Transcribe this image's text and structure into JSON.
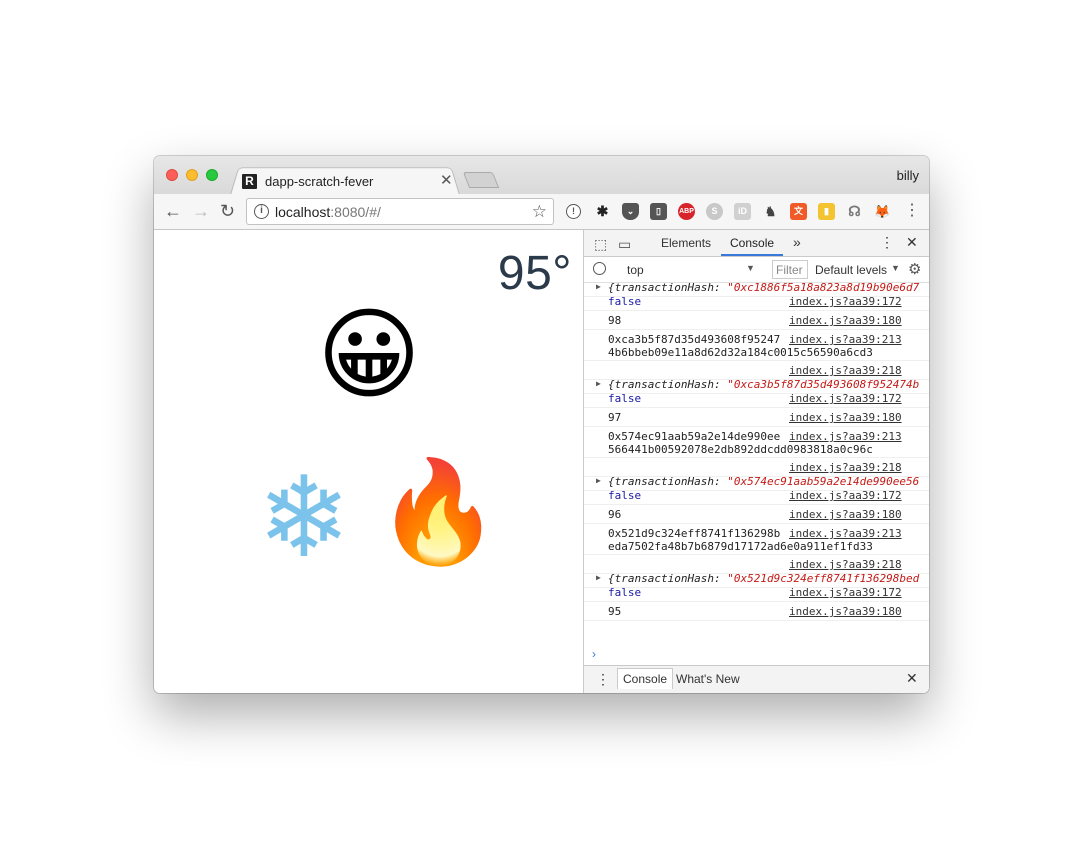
{
  "browser": {
    "tab_title": "dapp-scratch-fever",
    "favicon_letter": "R",
    "tab_close": "✕",
    "profile_name": "billy",
    "url_host": "localhost",
    "url_rest": ":8080/#/",
    "back": "←",
    "forward": "→",
    "reload": "↻",
    "star": "☆",
    "extensions": [
      "info-ext-icon",
      "password-ext-icon",
      "pocket-icon",
      "bitwarden-icon",
      "adblock-plus-icon",
      "skype-icon",
      "id-ext-icon",
      "evernote-icon",
      "translate-icon",
      "highlighter-icon",
      "ghostery-icon",
      "metamask-icon"
    ],
    "extension_labels": {
      "adblock": "ABP",
      "id": "iD"
    },
    "menu": "⋮"
  },
  "page": {
    "temperature": "95°",
    "face_emoji": "😀",
    "snow_emoji": "❄",
    "fire_emoji": "🔥"
  },
  "devtools": {
    "tabs": [
      "Elements",
      "Console"
    ],
    "more": "»",
    "context": "top",
    "filter_placeholder": "Filter",
    "levels": "Default levels",
    "drawer_tabs": [
      "Console",
      "What's New"
    ],
    "logs": [
      {
        "kind": "obj",
        "text": "{transactionHash: ",
        "str": "\"0xc1886f5a18a823a8d19b90e6d7"
      },
      {
        "kind": "bool",
        "text": "false",
        "src": "index.js?aa39:172"
      },
      {
        "kind": "plain",
        "text": "98",
        "src": "index.js?aa39:180"
      },
      {
        "kind": "hash",
        "text": "0xca3b5f87d35d493608f95247\n4b6bbeb09e11a8d62d32a184c0015c56590a6cd3",
        "src": "index.js?aa39:213"
      },
      {
        "kind": "srconly",
        "src": "index.js?aa39:218"
      },
      {
        "kind": "obj",
        "text": "{transactionHash: ",
        "str": "\"0xca3b5f87d35d493608f952474b"
      },
      {
        "kind": "bool",
        "text": "false",
        "src": "index.js?aa39:172"
      },
      {
        "kind": "plain",
        "text": "97",
        "src": "index.js?aa39:180"
      },
      {
        "kind": "hash",
        "text": "0x574ec91aab59a2e14de990ee\n566441b00592078e2db892ddcdd0983818a0c96c",
        "src": "index.js?aa39:213"
      },
      {
        "kind": "srconly",
        "src": "index.js?aa39:218"
      },
      {
        "kind": "obj",
        "text": "{transactionHash: ",
        "str": "\"0x574ec91aab59a2e14de990ee56"
      },
      {
        "kind": "bool",
        "text": "false",
        "src": "index.js?aa39:172"
      },
      {
        "kind": "plain",
        "text": "96",
        "src": "index.js?aa39:180"
      },
      {
        "kind": "hash",
        "text": "0x521d9c324eff8741f136298b\neda7502fa48b7b6879d17172ad6e0a911ef1fd33",
        "src": "index.js?aa39:213"
      },
      {
        "kind": "srconly",
        "src": "index.js?aa39:218"
      },
      {
        "kind": "obj",
        "text": "{transactionHash: ",
        "str": "\"0x521d9c324eff8741f136298bed"
      },
      {
        "kind": "bool",
        "text": "false",
        "src": "index.js?aa39:172"
      },
      {
        "kind": "plain",
        "text": "95",
        "src": "index.js?aa39:180"
      }
    ],
    "prompt": "›"
  }
}
